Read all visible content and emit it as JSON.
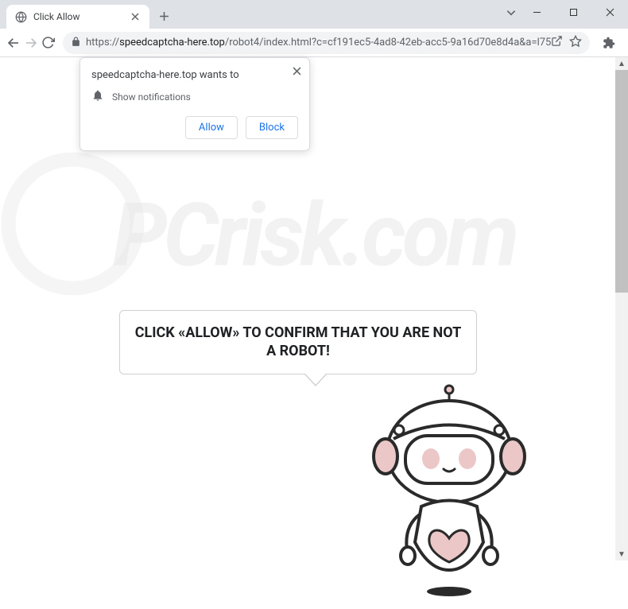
{
  "window": {
    "tab_title": "Click Allow",
    "url_scheme": "https://",
    "url_domain": "speedcaptcha-here.top",
    "url_path": "/robot4/index.html?c=cf191ec5-4ad8-42eb-acc5-9a16d70e8d4a&a=l75"
  },
  "permission": {
    "site_wants": "speedcaptcha-here.top wants to",
    "request": "Show notifications",
    "allow": "Allow",
    "block": "Block"
  },
  "page": {
    "speech_text": "CLICK «ALLOW» TO CONFIRM THAT YOU ARE NOT A ROBOT!"
  },
  "watermark": {
    "text": "PCrisk.com"
  }
}
